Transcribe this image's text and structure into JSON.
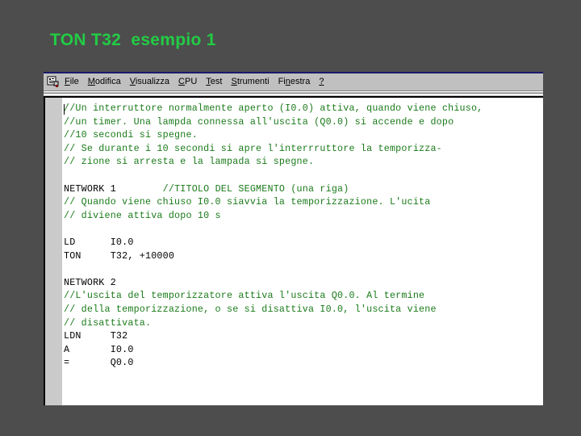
{
  "slide": {
    "title": "TON T32  esempio 1"
  },
  "window": {
    "app_icon": "document-editor-icon",
    "menu": [
      {
        "label": "File",
        "accel_index": 0
      },
      {
        "label": "Modifica",
        "accel_index": 0
      },
      {
        "label": "Visualizza",
        "accel_index": 0
      },
      {
        "label": "CPU",
        "accel_index": 0
      },
      {
        "label": "Test",
        "accel_index": 0
      },
      {
        "label": "Strumenti",
        "accel_index": 0
      },
      {
        "label": "Finestra",
        "accel_index": 2
      },
      {
        "label": "?",
        "accel_index": 0
      }
    ]
  },
  "editor": {
    "lines": [
      {
        "text": "//Un interruttore normalmente aperto (I0.0) attiva, quando viene chiuso,",
        "kind": "comment"
      },
      {
        "text": "//un timer. Una lampda connessa all'uscita (Q0.0) si accende e dopo",
        "kind": "comment"
      },
      {
        "text": "//10 secondi si spegne.",
        "kind": "comment"
      },
      {
        "text": "// Se durante i 10 secondi si apre l'interrruttore la temporizza-",
        "kind": "comment"
      },
      {
        "text": "// zione si arresta e la lampada si spegne.",
        "kind": "comment"
      },
      {
        "text": "",
        "kind": "blank"
      },
      {
        "text": "NETWORK 1",
        "kind": "network",
        "comment": "//TITOLO DEL SEGMENTO (una riga)"
      },
      {
        "text": "// Quando viene chiuso I0.0 siavvia la temporizzazione. L'ucita",
        "kind": "comment"
      },
      {
        "text": "// diviene attiva dopo 10 s",
        "kind": "comment"
      },
      {
        "text": "",
        "kind": "blank"
      },
      {
        "text": "LD      I0.0",
        "kind": "instr"
      },
      {
        "text": "TON     T32, +10000",
        "kind": "instr"
      },
      {
        "text": "",
        "kind": "blank"
      },
      {
        "text": "NETWORK 2",
        "kind": "instr"
      },
      {
        "text": "//L'uscita del temporizzatore attiva l'uscita Q0.0. Al termine",
        "kind": "comment"
      },
      {
        "text": "// della temporizzazione, o se si disattiva I0.0, l'uscita viene",
        "kind": "comment"
      },
      {
        "text": "// disattivata.",
        "kind": "comment"
      },
      {
        "text": "LDN     T32",
        "kind": "instr"
      },
      {
        "text": "A       I0.0",
        "kind": "instr"
      },
      {
        "text": "=       Q0.0",
        "kind": "instr"
      }
    ]
  },
  "colors": {
    "title_green": "#22cc44",
    "comment_green": "#1a7a1a",
    "background": "#4d4d4d"
  }
}
